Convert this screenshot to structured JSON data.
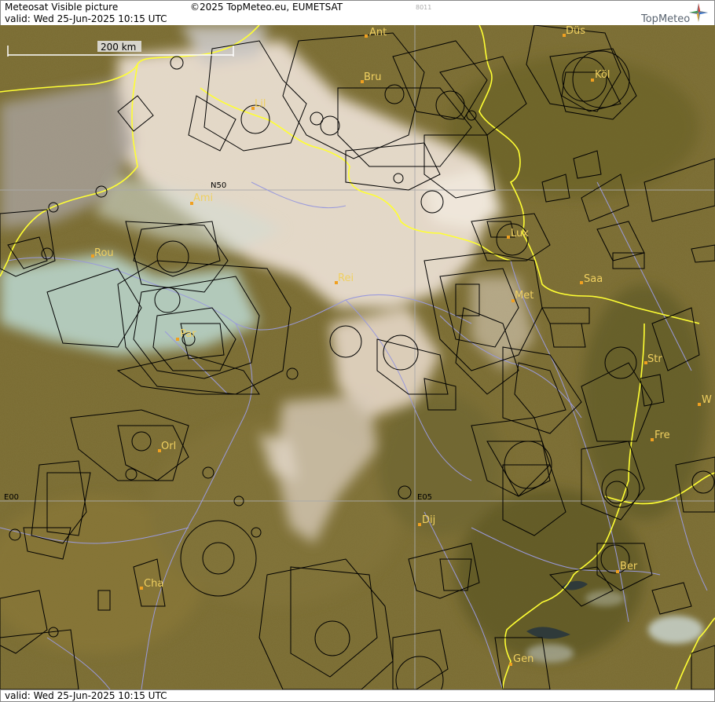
{
  "header": {
    "product": "Meteosat Visible picture",
    "valid": "valid:  Wed  25-Jun-2025  10:15 UTC",
    "copyright": "©2025 TopMeteo.eu, EUMETSAT",
    "code": "8011",
    "brand": "TopMeteo",
    "logo_icon": "compass-star-icon"
  },
  "scale_bar": {
    "label": "200 km"
  },
  "grid_labels": {
    "lat_n50": "N50",
    "lon_e00": "E00",
    "lon_e05": "E05"
  },
  "cities": [
    {
      "name": "Ant"
    },
    {
      "name": "Düs"
    },
    {
      "name": "Bru"
    },
    {
      "name": "Köl"
    },
    {
      "name": "Lil"
    },
    {
      "name": "Ami"
    },
    {
      "name": "Lux"
    },
    {
      "name": "Rou"
    },
    {
      "name": "Rei"
    },
    {
      "name": "Saa"
    },
    {
      "name": "Met"
    },
    {
      "name": "Par"
    },
    {
      "name": "Str"
    },
    {
      "name": "W"
    },
    {
      "name": "Fre"
    },
    {
      "name": "Orl"
    },
    {
      "name": "Dij"
    },
    {
      "name": "Ber"
    },
    {
      "name": "Cha"
    },
    {
      "name": "Gen"
    }
  ],
  "footer": {
    "valid": "valid:  Wed  25-Jun-2025  10:15 UTC"
  },
  "colors": {
    "terrain": "#7a6b30",
    "terrain_dark": "#5f5626",
    "cloud": "#e8ddd0",
    "snow_haze": "#bfe0dc",
    "border": "#ffff33",
    "river": "#9a9adc",
    "airspace": "#000000",
    "grid": "#a9a9a9",
    "city_label": "#f0d060",
    "city_dot": "#f0a020"
  }
}
